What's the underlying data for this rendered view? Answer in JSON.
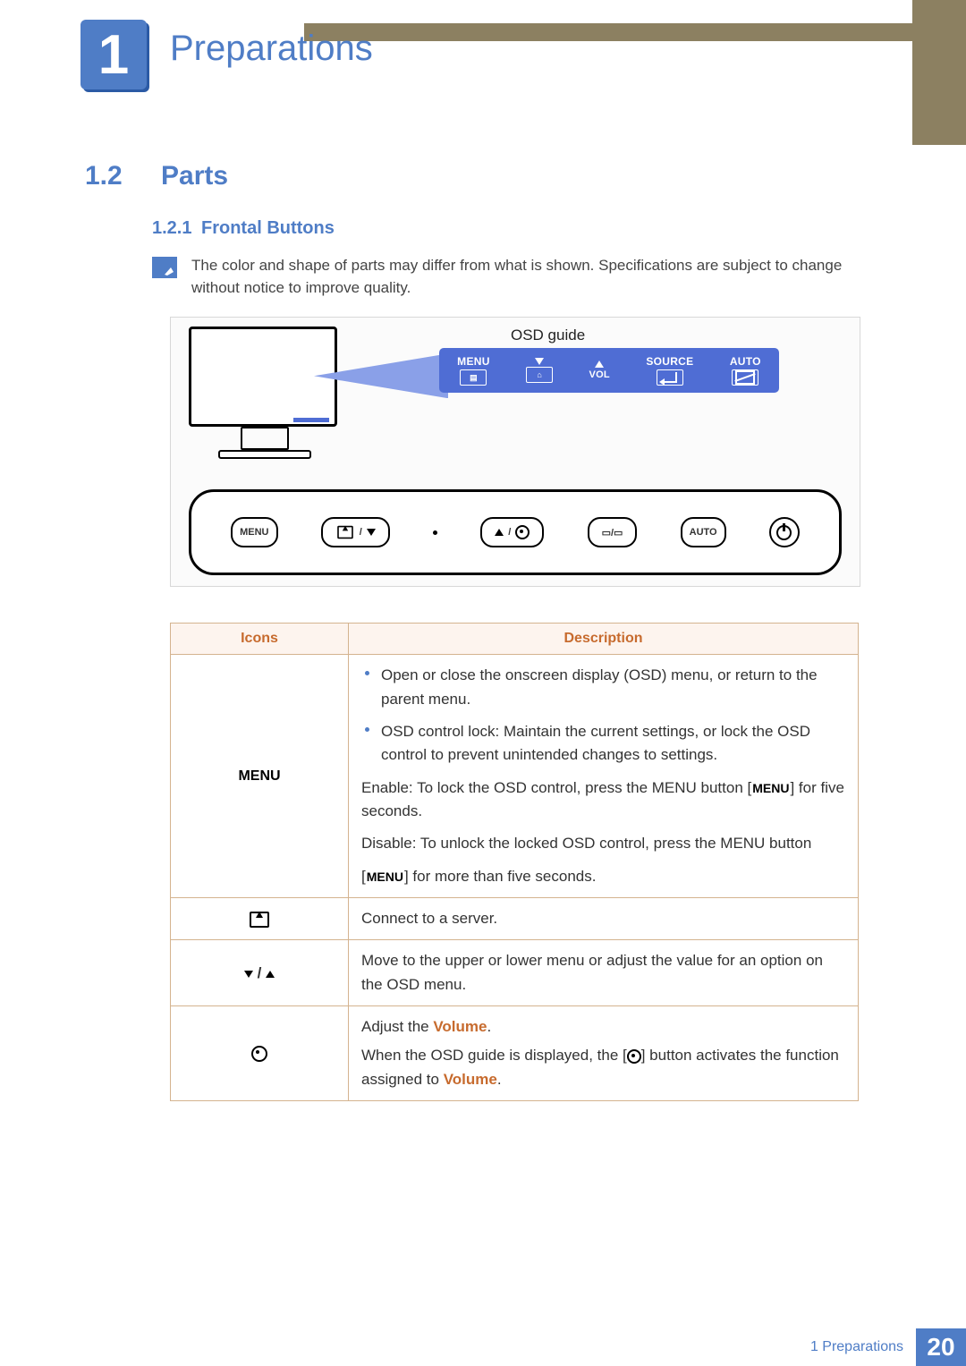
{
  "chapter": {
    "num": "1",
    "title": "Preparations"
  },
  "section": {
    "num": "1.2",
    "title": "Parts"
  },
  "subsection": {
    "num": "1.2.1",
    "title": "Frontal Buttons"
  },
  "note": "The color and shape of parts may differ from what is shown. Specifications are subject to change without notice to improve quality.",
  "diagram": {
    "osd_label": "OSD guide",
    "osd_items": {
      "menu": "MENU",
      "vol": "VOL",
      "source": "SOURCE",
      "auto": "AUTO"
    },
    "btn_menu": "MENU",
    "btn_auto": "AUTO"
  },
  "table": {
    "headers": {
      "icons": "Icons",
      "desc": "Description"
    },
    "rows": {
      "menu": {
        "icon_label": "MENU",
        "bullet1": "Open or close the onscreen display (OSD) menu, or return to the parent menu.",
        "bullet2": "OSD control lock: Maintain the current settings, or lock the OSD control to prevent unintended changes to settings.",
        "enable_pre": "Enable: To lock the OSD control, press the MENU button [",
        "enable_badge": "MENU",
        "enable_post": "] for five seconds.",
        "disable_pre": "Disable: To unlock the locked OSD control, press the MENU button",
        "disable_bracket_open": "[",
        "disable_badge": "MENU",
        "disable_bracket_close": "] for more than five seconds."
      },
      "server": {
        "desc": "Connect to a server."
      },
      "arrows": {
        "desc": "Move to the upper or lower menu or adjust the value for an option on the OSD menu."
      },
      "record": {
        "line1_pre": "Adjust the ",
        "line1_hl": "Volume",
        "line1_post": ".",
        "line2_pre": "When the OSD guide is displayed, the [",
        "line2_post": "] button activates the function assigned to ",
        "line2_hl": "Volume",
        "line2_end": "."
      }
    }
  },
  "footer": {
    "text": "1 Preparations",
    "page": "20"
  }
}
